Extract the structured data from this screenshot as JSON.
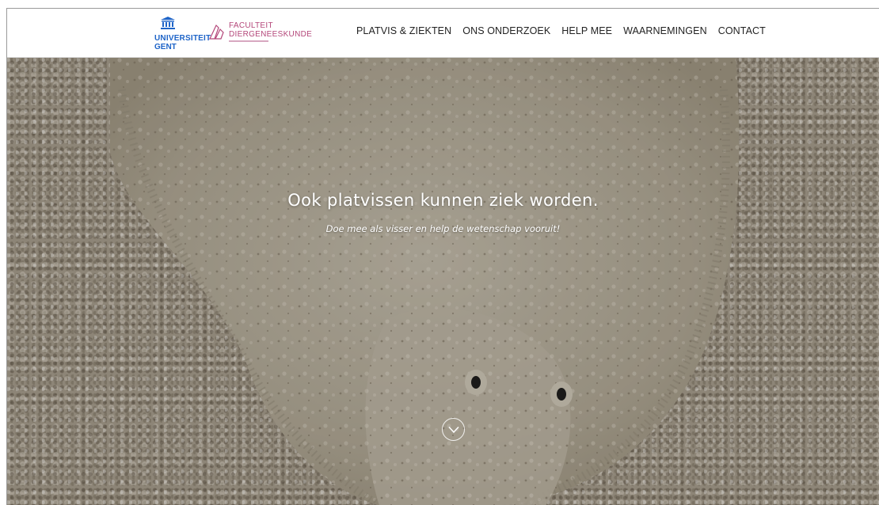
{
  "header": {
    "logo_ugent": {
      "line1": "UNIVERSITEIT",
      "line2": "GENT"
    },
    "logo_faculty": {
      "line1": "FACULTEIT",
      "line2": "DIERGENEESKUNDE"
    },
    "nav": [
      {
        "label": "PLATVIS & ZIEKTEN"
      },
      {
        "label": "ONS ONDERZOEK"
      },
      {
        "label": "HELP MEE"
      },
      {
        "label": "WAARNEMINGEN"
      },
      {
        "label": "CONTACT"
      }
    ]
  },
  "hero": {
    "title": "Ook platvissen kunnen ziek worden.",
    "subtitle": "Doe mee als visser en help de wetenschap vooruit!",
    "scroll_icon": "chevron-down-icon",
    "background": "flatfish-on-gravel-photo"
  },
  "colors": {
    "ugent_blue": "#1e64c8",
    "faculty_pink": "#b4477a",
    "nav_text": "#222222",
    "hero_text": "#ffffff"
  }
}
